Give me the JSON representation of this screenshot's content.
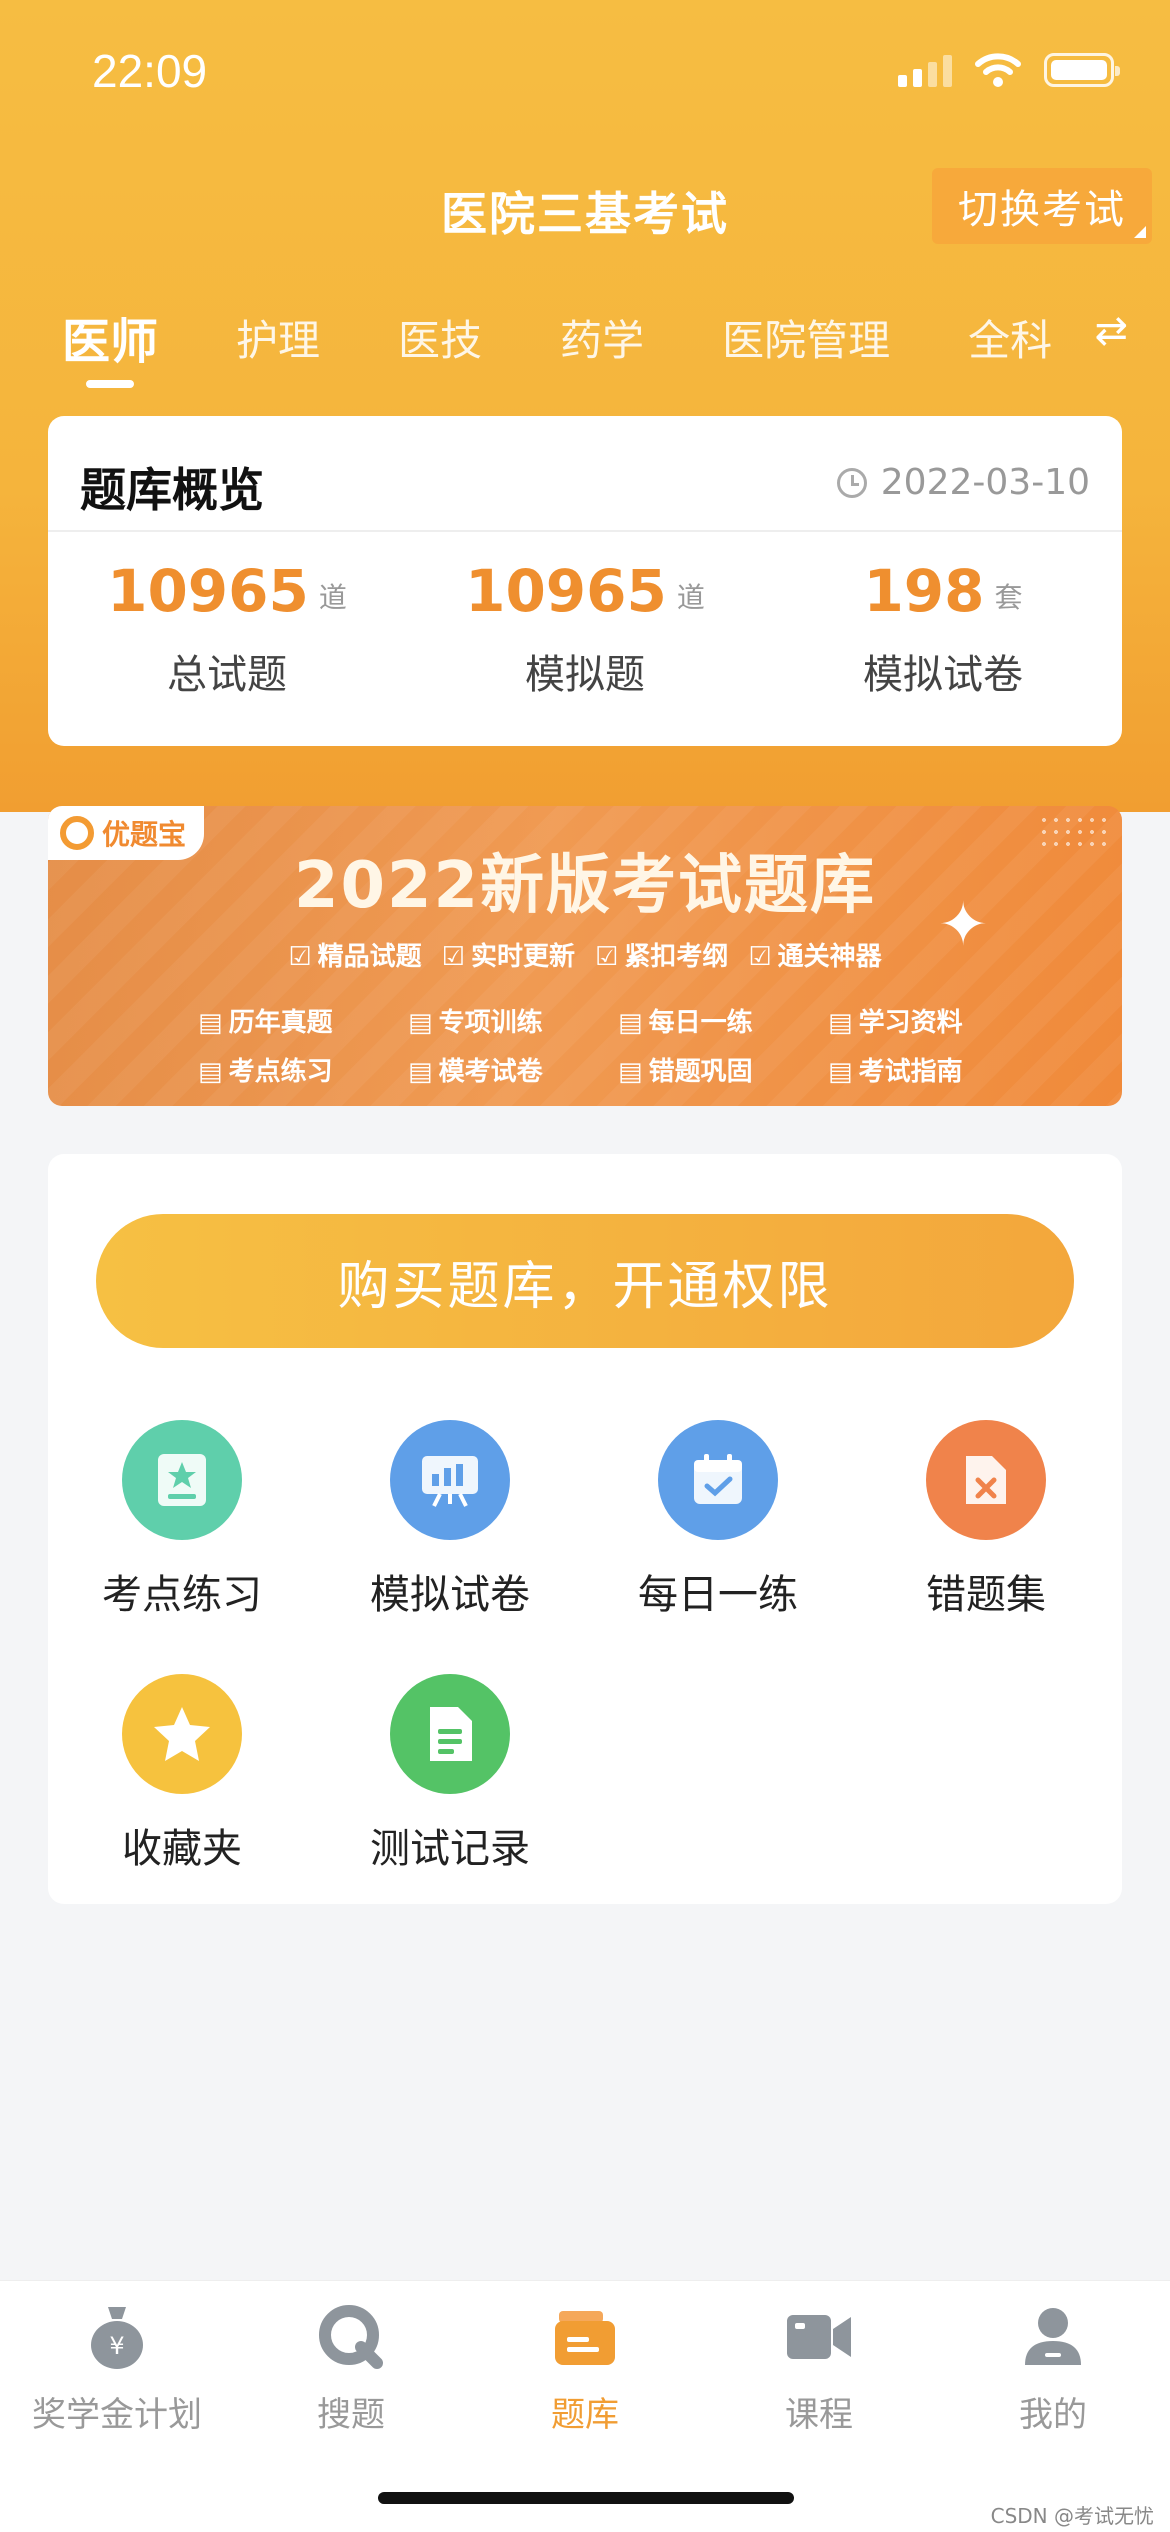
{
  "status": {
    "time": "22:09"
  },
  "header": {
    "title": "医院三基考试",
    "switch_label": "切换考试"
  },
  "tabs": [
    {
      "label": "医师",
      "active": true
    },
    {
      "label": "护理"
    },
    {
      "label": "医技"
    },
    {
      "label": "药学"
    },
    {
      "label": "医院管理"
    },
    {
      "label": "全科"
    }
  ],
  "overview": {
    "title": "题库概览",
    "date": "2022-03-10",
    "stats": [
      {
        "value": "10965",
        "unit": "道",
        "label": "总试题"
      },
      {
        "value": "10965",
        "unit": "道",
        "label": "模拟题"
      },
      {
        "value": "198",
        "unit": "套",
        "label": "模拟试卷"
      }
    ]
  },
  "banner": {
    "badge": "优题宝",
    "title": "2022新版考试题库",
    "tags": [
      "精品试题",
      "实时更新",
      "紧扣考纲",
      "通关神器"
    ],
    "grid": [
      "历年真题",
      "专项训练",
      "每日一练",
      "学习资料",
      "考点练习",
      "模考试卷",
      "错题巩固",
      "考试指南"
    ]
  },
  "buy_button": "购买题库，开通权限",
  "features": [
    {
      "label": "考点练习",
      "icon": "star-book-icon",
      "color": "#5fcfab"
    },
    {
      "label": "模拟试卷",
      "icon": "presentation-chart-icon",
      "color": "#5f9fe8"
    },
    {
      "label": "每日一练",
      "icon": "calendar-check-icon",
      "color": "#5f9fe8"
    },
    {
      "label": "错题集",
      "icon": "error-folder-icon",
      "color": "#f0834b"
    },
    {
      "label": "收藏夹",
      "icon": "star-icon",
      "color": "#f6c23e"
    },
    {
      "label": "测试记录",
      "icon": "document-icon",
      "color": "#54c366"
    }
  ],
  "nav": [
    {
      "label": "奖学金计划",
      "icon": "money-bag-icon"
    },
    {
      "label": "搜题",
      "icon": "search-icon"
    },
    {
      "label": "题库",
      "icon": "question-bank-icon",
      "active": true
    },
    {
      "label": "课程",
      "icon": "video-camera-icon"
    },
    {
      "label": "我的",
      "icon": "profile-icon"
    }
  ],
  "watermark": "CSDN @考试无忧"
}
